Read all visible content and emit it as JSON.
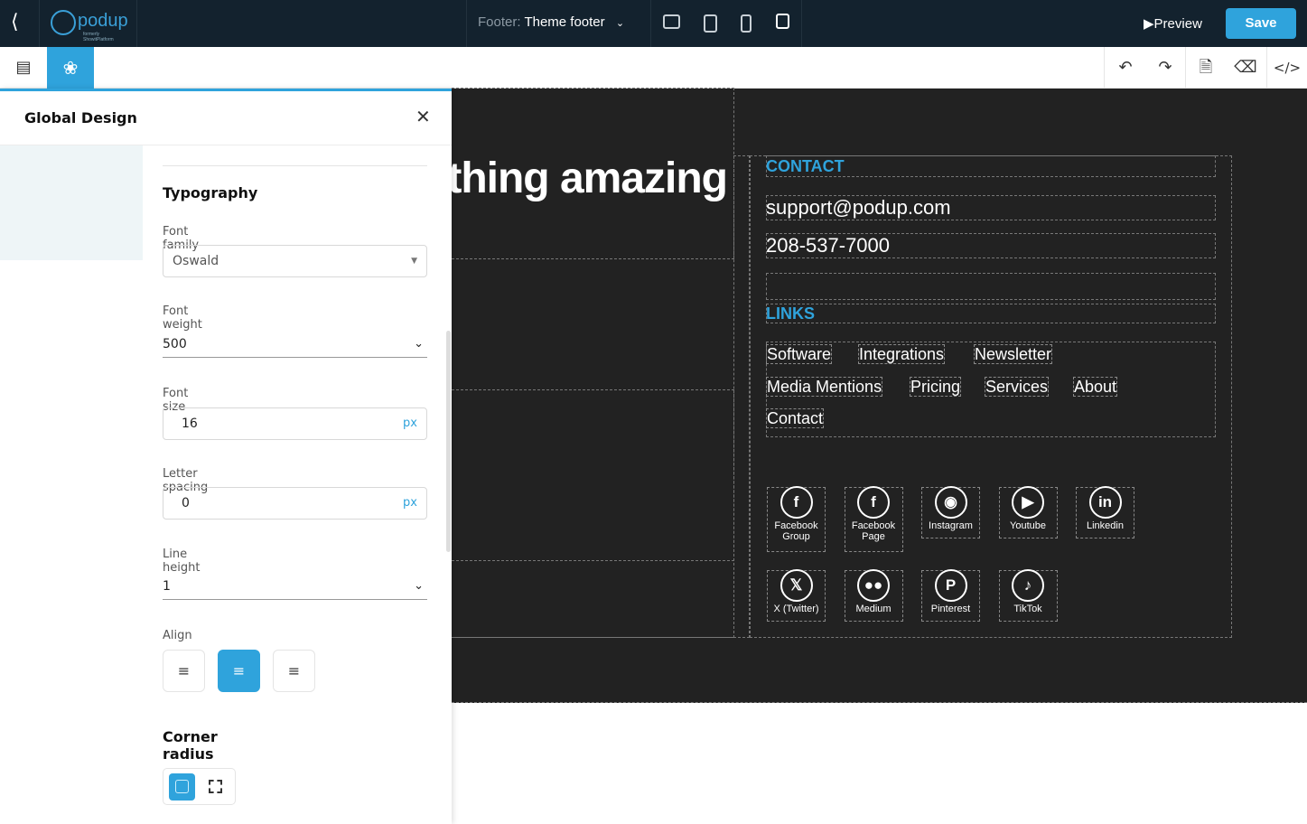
{
  "topbar": {
    "logo": "podup",
    "logo_sub": "formerly ShowitPlatform",
    "footer_label": "Footer:",
    "footer_value": "Theme footer",
    "preview": "Preview",
    "save": "Save"
  },
  "panel": {
    "title": "Global Design",
    "typography": "Typography",
    "font_family_label": "Font family",
    "font_family": "Oswald",
    "font_weight_label": "Font weight",
    "font_weight": "500",
    "font_size_label": "Font size",
    "font_size": "16",
    "font_size_unit": "px",
    "letter_spacing_label": "Letter spacing",
    "letter_spacing": "0",
    "letter_spacing_unit": "px",
    "line_height_label": "Line height",
    "line_height": "1",
    "align_label": "Align",
    "align_selected": "center",
    "corner_radius": "Corner radius"
  },
  "canvas": {
    "heading": "thing amazing",
    "contact_title": "CONTACT",
    "email": "support@podup.com",
    "phone": "208-537-7000",
    "links_title": "LINKS",
    "links": [
      "Software",
      "Integrations",
      "Newsletter",
      "Media Mentions",
      "Pricing",
      "Services",
      "About",
      "Contact"
    ],
    "social": [
      {
        "label": "Facebook Group",
        "icon": "facebook-icon"
      },
      {
        "label": "Facebook Page",
        "icon": "facebook-icon"
      },
      {
        "label": "Instagram",
        "icon": "instagram-icon"
      },
      {
        "label": "Youtube",
        "icon": "youtube-icon"
      },
      {
        "label": "Linkedin",
        "icon": "linkedin-icon"
      },
      {
        "label": "X (Twitter)",
        "icon": "x-icon"
      },
      {
        "label": "Medium",
        "icon": "medium-icon"
      },
      {
        "label": "Pinterest",
        "icon": "pinterest-icon"
      },
      {
        "label": "TikTok",
        "icon": "tiktok-icon"
      }
    ]
  },
  "colors": {
    "accent": "#2fa3dc",
    "topbar": "#13222e",
    "canvas": "#222222"
  }
}
